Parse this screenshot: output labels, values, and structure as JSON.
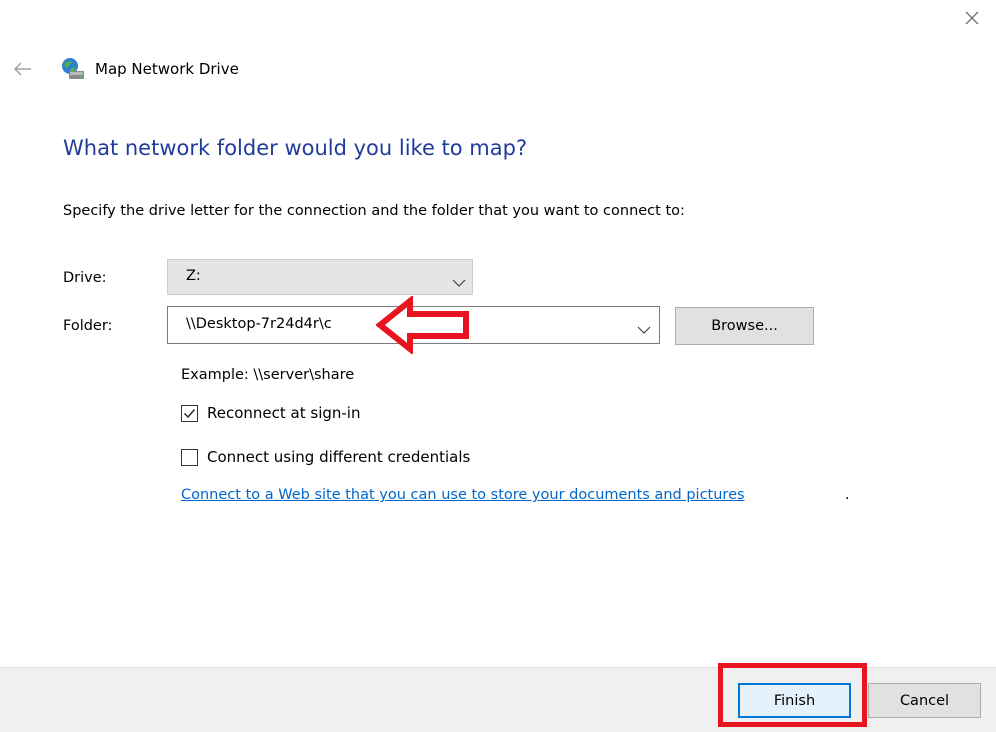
{
  "window": {
    "title": "Map Network Drive",
    "close_icon": "close-icon",
    "back_icon": "back-arrow-icon",
    "app_icon": "network-drive-icon"
  },
  "main": {
    "heading": "What network folder would you like to map?",
    "instruction": "Specify the drive letter for the connection and the folder that you want to connect to:",
    "drive": {
      "label": "Drive:",
      "value": "Z:"
    },
    "folder": {
      "label": "Folder:",
      "value": "\\\\Desktop-7r24d4r\\c",
      "browse_label": "Browse..."
    },
    "example": "Example: \\\\server\\share",
    "reconnect": {
      "label": "Reconnect at sign-in",
      "checked": true
    },
    "different_credentials": {
      "label": "Connect using different credentials",
      "checked": false
    },
    "web_link": "Connect to a Web site that you can use to store your documents and pictures",
    "web_link_suffix": "."
  },
  "footer": {
    "finish_label": "Finish",
    "cancel_label": "Cancel"
  },
  "colors": {
    "heading": "#1f3c9a",
    "link": "#0066cc",
    "annotation": "#e8141f",
    "default_button_border": "#0078d7"
  }
}
